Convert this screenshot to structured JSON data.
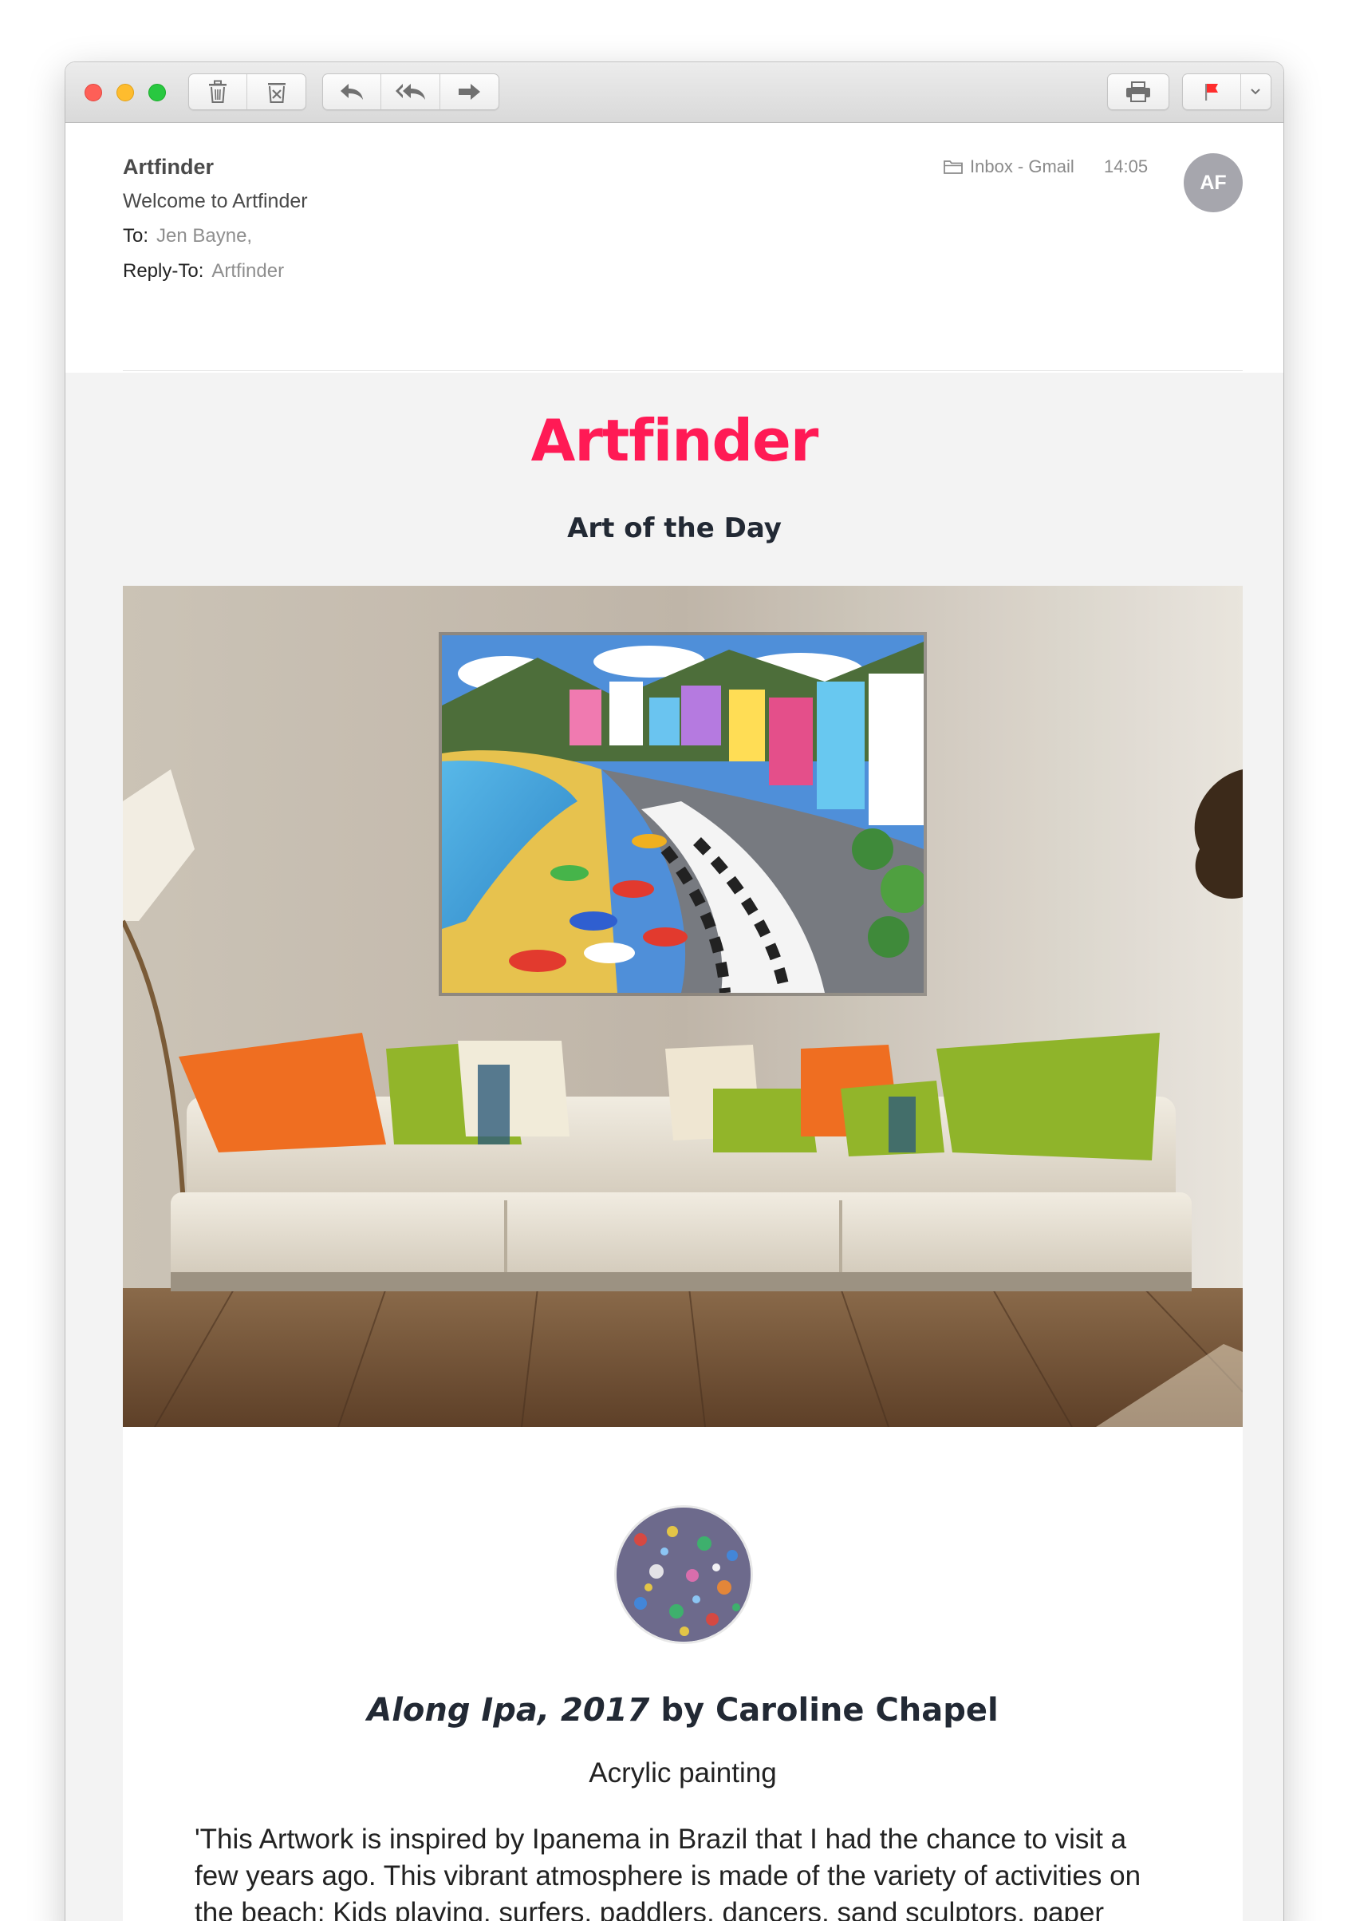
{
  "toolbar": {
    "buttons": [
      {
        "name": "trash",
        "icon": "trash-icon"
      },
      {
        "name": "junk",
        "icon": "junk-icon"
      },
      {
        "name": "reply",
        "icon": "reply-icon"
      },
      {
        "name": "reply-all",
        "icon": "reply-all-icon"
      },
      {
        "name": "forward",
        "icon": "forward-icon"
      },
      {
        "name": "print",
        "icon": "print-icon"
      },
      {
        "name": "flag",
        "icon": "flag-icon",
        "color": "#ff2d2d"
      },
      {
        "name": "flag-menu",
        "icon": "chevron-down-icon"
      }
    ]
  },
  "message": {
    "from": "Artfinder",
    "subject": "Welcome to Artfinder",
    "to_label": "To:",
    "to_value": "Jen Bayne,",
    "reply_to_label": "Reply-To:",
    "reply_to_value": "Artfinder",
    "mailbox": "Inbox - Gmail",
    "time": "14:05",
    "avatar_initials": "AF"
  },
  "email": {
    "logo": "Artfinder",
    "tagline": "Art of the Day",
    "artwork_title": "Along Ipa, 2017",
    "artwork_by": "by Caroline Chapel",
    "medium": "Acrylic painting",
    "description": "'This Artwork is inspired by Ipanema in Brazil that I had the chance to visit a few years ago. This vibrant atmosphere is made of the variety of activities on the beach: Kids playing, surfers, paddlers, dancers, sand sculptors, paper readers, coconut water sippers... There is something for everyone.'"
  },
  "colors": {
    "brand": "#ff1a55",
    "title_text": "#222934",
    "avatar_bg": "#a6a6ad"
  }
}
